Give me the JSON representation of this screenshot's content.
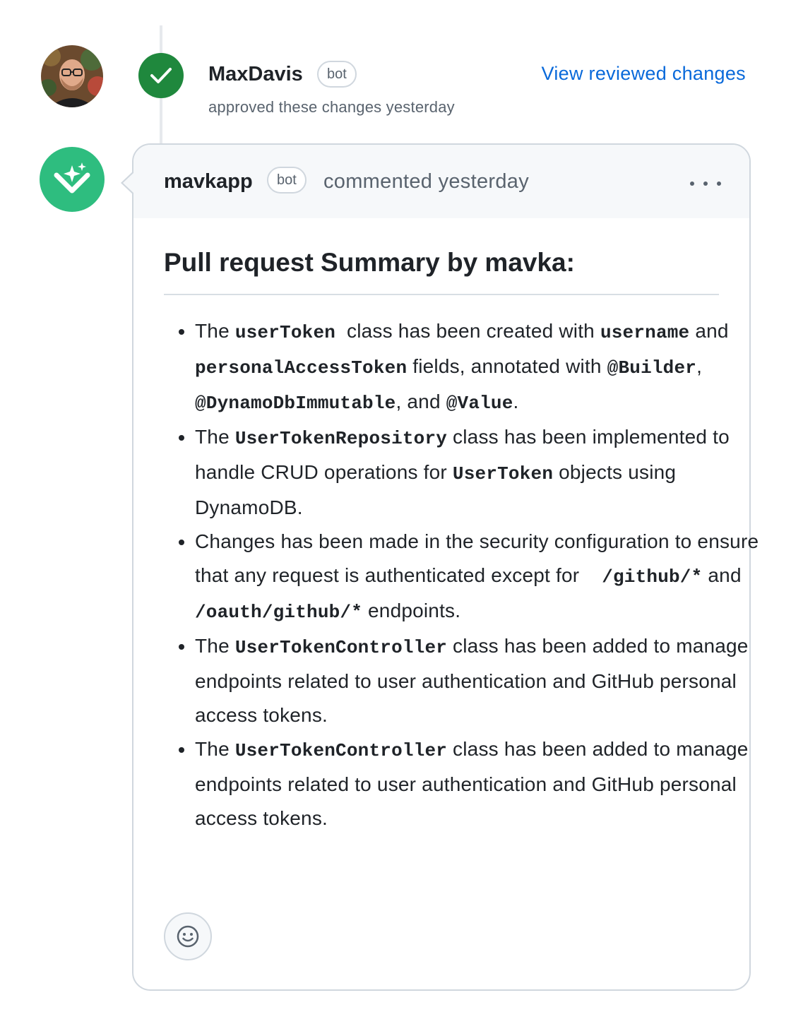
{
  "review": {
    "reviewer_name": "MaxDavis",
    "bot_label": "bot",
    "action_text": "approved these changes yesterday",
    "view_link": "View reviewed changes"
  },
  "comment": {
    "author": "mavkapp",
    "bot_label": "bot",
    "action_text": "commented yesterday",
    "title": "Pull request Summary by mavka:",
    "items": [
      {
        "p1": "The ",
        "c1": "userToken",
        "p2": "  class has been created with ",
        "c2": "username",
        "p3": " and ",
        "c3": "personalAccessToken",
        "p4": " fields, annotated with ",
        "c4": "@Builder",
        "p5": ", ",
        "c5": "@DynamoDbImmutable",
        "p6": ", and ",
        "c6": "@Value",
        "p7": "."
      },
      {
        "p1": "The ",
        "c1": "UserTokenRepository",
        "p2": " class has been implemented to handle CRUD operations for ",
        "c2": "UserToken",
        "p3": " objects using DynamoDB."
      },
      {
        "p1": "Changes has been made in the security configuration to ensure that any request is authenticated except for ",
        "c1": "/github/*",
        "p2": " and ",
        "c2": "/oauth/github/*",
        "p3": " endpoints."
      },
      {
        "p1": "The ",
        "c1": "UserTokenController",
        "p2": " class has been added to manage endpoints related to user authentication and GitHub personal access tokens."
      },
      {
        "p1": "The ",
        "c1": "UserTokenController",
        "p2": " class has been added to manage endpoints related to user authentication and GitHub personal access tokens."
      }
    ]
  },
  "icons": {
    "avatar": "user-avatar",
    "approved": "check-icon",
    "app": "mavka-logo-icon",
    "more": "kebab-horizontal-icon",
    "reaction": "smiley-icon"
  },
  "colors": {
    "approve_green": "#1f883d",
    "app_green": "#2ebd7f",
    "link_blue": "#0969da",
    "muted_text": "#59636e",
    "border": "#d0d7de"
  }
}
